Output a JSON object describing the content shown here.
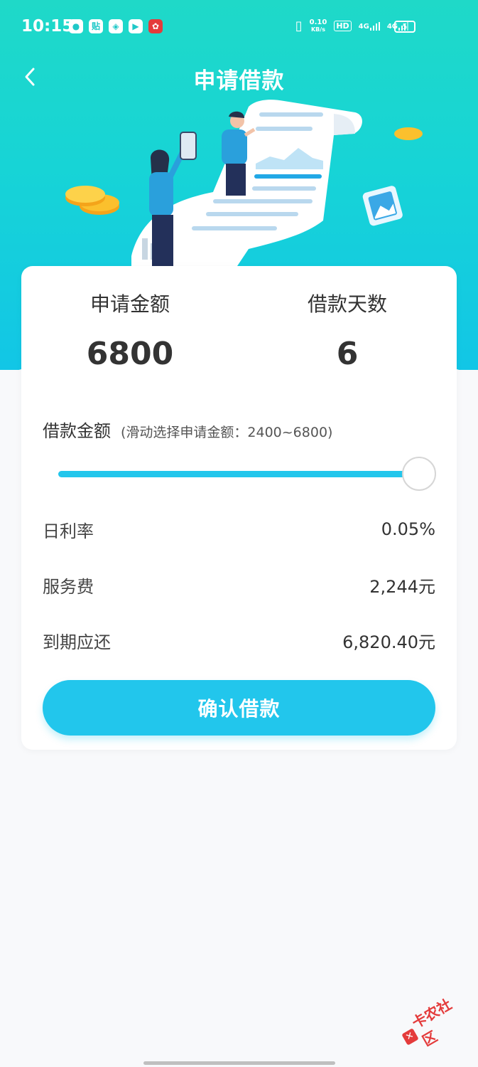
{
  "status": {
    "time": "10:15",
    "left_icons": [
      "chat-icon",
      "tie-icon",
      "app-icon",
      "video-icon",
      "gift-icon"
    ],
    "net_speed": "0.10",
    "net_unit": "KB/s",
    "hd": "HD",
    "sig1": "4G",
    "sig2": "4G",
    "battery": "5"
  },
  "header": {
    "title": "申请借款"
  },
  "summary": {
    "amount_label": "申请金额",
    "amount_value": "6800",
    "days_label": "借款天数",
    "days_value": "6"
  },
  "loan": {
    "label": "借款金额",
    "hint": "(滑动选择申请金额：2400~6800)",
    "slider_min": 2400,
    "slider_max": 6800,
    "slider_value": 6800
  },
  "info": {
    "rate_label": "日利率",
    "rate_value": "0.05%",
    "fee_label": "服务费",
    "fee_value": "2,244元",
    "due_label": "到期应还",
    "due_value": "6,820.40元"
  },
  "confirm_label": "确认借款",
  "watermark": "卡农社区",
  "colors": {
    "accent": "#22c6ec",
    "hero_top": "#1fd9c8",
    "hero_bottom": "#12c6e6"
  }
}
